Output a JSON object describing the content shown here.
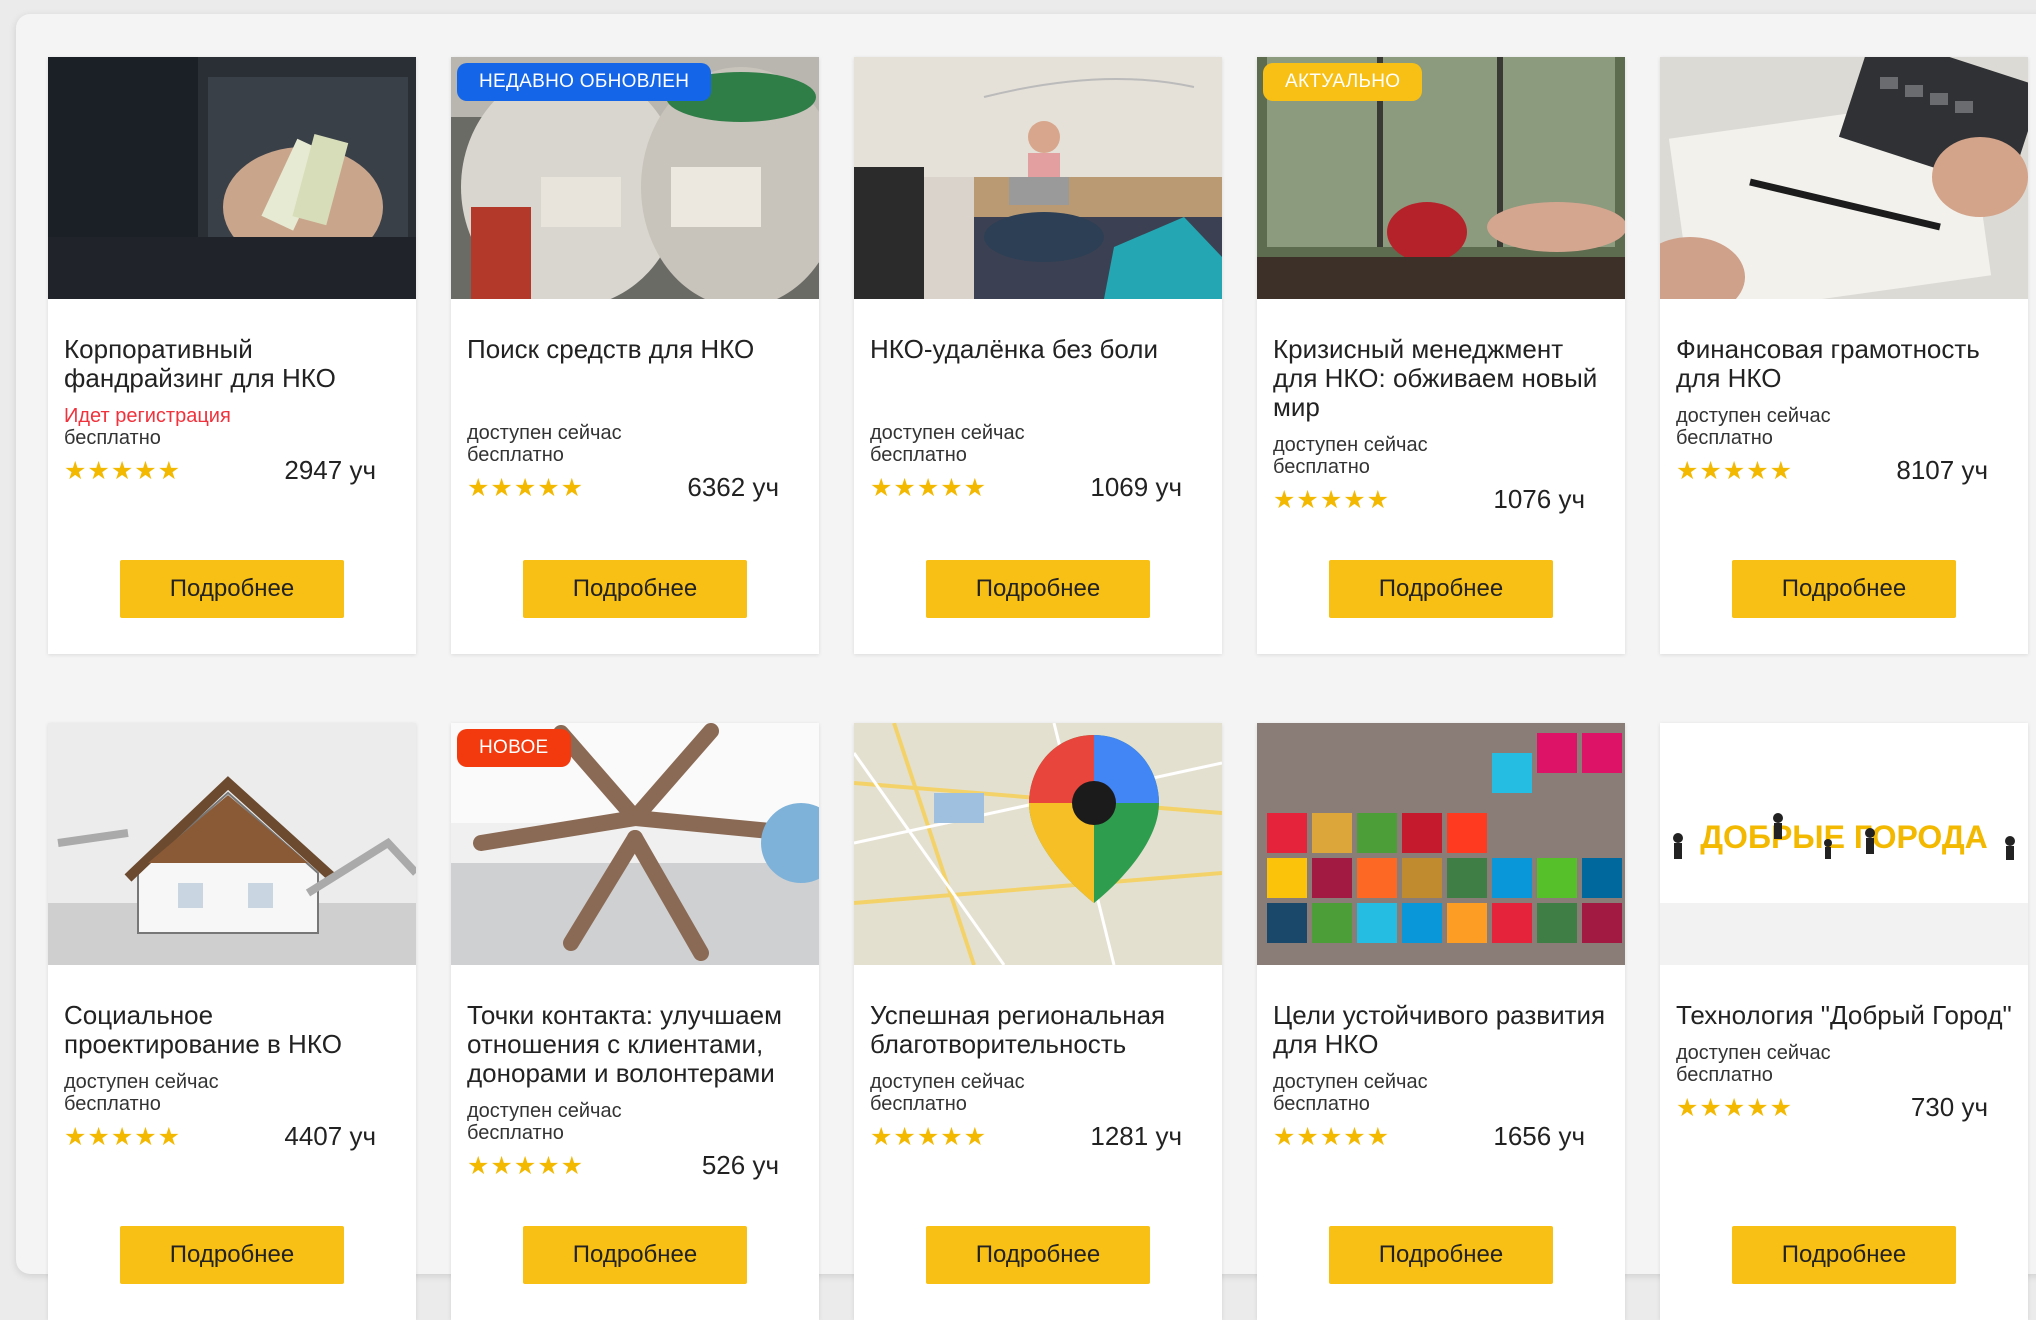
{
  "colors": {
    "accent": "#f8c015",
    "badge_blue": "#1565e8",
    "badge_red": "#f23a0e",
    "registration": "#f0323c"
  },
  "courses": [
    {
      "title": "Корпоративный фандрайзинг для НКО",
      "badge": "",
      "registration": "Идет регистрация",
      "status": "",
      "price": "бесплатно",
      "stars": "★★★★★",
      "participants": "2947 уч",
      "button": "Подробнее"
    },
    {
      "title": "Поиск средств для НКО",
      "badge": "НЕДАВНО ОБНОВЛЕН",
      "registration": "",
      "status": "доступен сейчас",
      "price": "бесплатно",
      "stars": "★★★★★",
      "participants": "6362 уч",
      "button": "Подробнее"
    },
    {
      "title": "НКО-удалёнка без боли",
      "badge": "",
      "registration": "",
      "status": "доступен сейчас",
      "price": "бесплатно",
      "stars": "★★★★★",
      "participants": "1069 уч",
      "button": "Подробнее"
    },
    {
      "title": "Кризисный менеджмент для НКО: обживаем новый мир",
      "badge": "АКТУАЛЬНО",
      "registration": "",
      "status": "доступен сейчас",
      "price": "бесплатно",
      "stars": "★★★★★",
      "participants": "1076 уч",
      "button": "Подробнее"
    },
    {
      "title": "Финансовая грамотность для НКО",
      "badge": "",
      "registration": "",
      "status": "доступен сейчас",
      "price": "бесплатно",
      "stars": "★★★★★",
      "participants": "8107 уч",
      "button": "Подробнее"
    },
    {
      "title": "Социальное проектирование в НКО",
      "badge": "",
      "registration": "",
      "status": "доступен сейчас",
      "price": "бесплатно",
      "stars": "★★★★★",
      "participants": "4407 уч",
      "button": "Подробнее"
    },
    {
      "title": "Точки контакта: улучшаем отношения с клиентами, донорами и волонтерами",
      "badge": "НОВОЕ",
      "registration": "",
      "status": "доступен сейчас",
      "price": "бесплатно",
      "stars": "★★★★★",
      "participants": "526 уч",
      "button": "Подробнее"
    },
    {
      "title": "Успешная региональная благотворительность",
      "badge": "",
      "registration": "",
      "status": "доступен сейчас",
      "price": "бесплатно",
      "stars": "★★★★★",
      "participants": "1281 уч",
      "button": "Подробнее"
    },
    {
      "title": "Цели устойчивого развития для НКО",
      "badge": "",
      "registration": "",
      "status": "доступен сейчас",
      "price": "бесплатно",
      "stars": "★★★★★",
      "participants": "1656 уч",
      "button": "Подробнее"
    },
    {
      "title": "Технология \"Добрый Город\"",
      "badge": "",
      "registration": "",
      "status": "доступен сейчас",
      "price": "бесплатно",
      "stars": "★★★★★",
      "participants": "730 уч",
      "button": "Подробнее"
    }
  ],
  "logo_text": "ДОБРЫЕ ГОРОДА"
}
